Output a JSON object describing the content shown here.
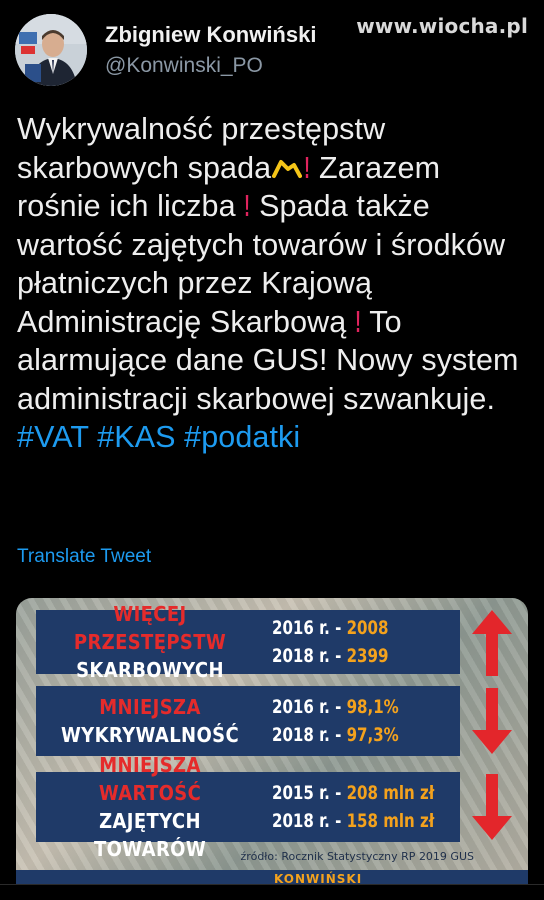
{
  "watermark": "www.wiocha.pl",
  "author": {
    "name": "Zbigniew Konwiński",
    "handle": "@Konwinski_PO"
  },
  "tweet": {
    "segments": [
      {
        "t": "Wykrywalność przestępstw skarbowych spada"
      },
      {
        "icon": "chart-down-emoji"
      },
      {
        "excl": "!"
      },
      {
        "t": "  Zarazem rośnie ich liczba "
      },
      {
        "excl": "!"
      },
      {
        "t": "  Spada także wartość zajętych towarów i środków płatniczych przez Krajową Administrację Skarbową "
      },
      {
        "excl": "!"
      },
      {
        "t": "  To alarmujące dane GUS! Nowy system administracji skarbowej szwankuje. "
      },
      {
        "tag": "#VAT"
      },
      {
        "t": " "
      },
      {
        "tag": "#KAS"
      },
      {
        "t": " "
      },
      {
        "tag": "#podatki"
      }
    ]
  },
  "translate_label": "Translate Tweet",
  "infographic": {
    "rows": [
      {
        "line1": "WIĘCEJ PRZESTĘPSTW",
        "line2": "SKARBOWYCH",
        "v1_year": "2016 r. - ",
        "v1_value": "2008",
        "v2_year": "2018 r. - ",
        "v2_value": "2399",
        "arrow": "up"
      },
      {
        "line1": "MNIEJSZA",
        "line2": "WYKRYWALNOŚĆ",
        "v1_year": "2016 r. - ",
        "v1_value": "98,1%",
        "v2_year": "2018 r. - ",
        "v2_value": "97,3%",
        "arrow": "down"
      },
      {
        "line1": "MNIEJSZA WARTOŚĆ",
        "line2": "ZAJĘTYCH TOWARÓW",
        "v1_year": "2015 r. - ",
        "v1_value": "208 mln zł",
        "v2_year": "2018 r. - ",
        "v2_value": "158 mln zł",
        "arrow": "down"
      }
    ],
    "source": "źródło: Rocznik Statystyczny RP 2019 GUS",
    "footer_brand": "KONWIŃSKI",
    "colors": {
      "panel": "#1f3a68",
      "red": "#e52b2b",
      "orange": "#f4a21d",
      "arrow": "#e3262b"
    }
  }
}
